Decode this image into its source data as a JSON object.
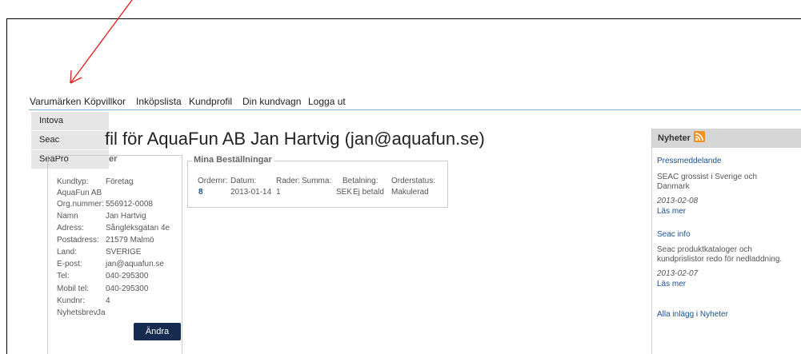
{
  "nav": {
    "items": [
      "Varumärken",
      "Köpvillkor",
      "Inköpslista",
      "Kundprofil",
      "Din kundvagn",
      "Logga ut"
    ]
  },
  "dropdown": {
    "items": [
      "Intova",
      "Seac",
      "SeaPro"
    ]
  },
  "profile": {
    "title": "fil för AquaFun AB Jan Hartvig (jan@aquafun.se)",
    "legend_fragment": "er",
    "fields": [
      {
        "label": "Kundtyp:",
        "value": "Företag"
      },
      {
        "label": "AquaFun AB",
        "value": ""
      },
      {
        "label": "Org.nummer:",
        "value": "556912-0008"
      },
      {
        "label": "Namn",
        "value": "Jan Hartvig"
      },
      {
        "label": "Adress:",
        "value": "Sångleksgatan 4e"
      },
      {
        "label": "Postadress:",
        "value": "21579 Malmö"
      },
      {
        "label": "Land:",
        "value": "SVERIGE"
      },
      {
        "label": "E-post:",
        "value": "jan@aquafun.se"
      },
      {
        "label": "Tel:",
        "value": "040-295300"
      },
      {
        "label": "Mobil tel:",
        "value": "040-295300"
      },
      {
        "label": "Kundnr:",
        "value": "4"
      },
      {
        "label": "Nyhetsbrev:",
        "value": "Ja"
      }
    ],
    "edit_button": "Ändra"
  },
  "orders": {
    "legend": "Mina Beställningar",
    "headers": [
      "Ordernr:",
      "Datum:",
      "Rader:",
      "Summa:",
      "Betalning:",
      "Orderstatus:"
    ],
    "rows": [
      {
        "ordernr": "8",
        "datum": "2013-01-14",
        "rader": "1",
        "summa": "SEK",
        "betalning": "Ej betald",
        "status": "Makulerad"
      }
    ]
  },
  "news": {
    "title": "Nyheter",
    "items": [
      {
        "heading": "Pressmeddelande",
        "text1": "SEAC grossist i Sverige och",
        "text2": "Danmark",
        "date": "2013-02-08",
        "more": "Läs mer"
      },
      {
        "heading": "Seac info",
        "text1": "Seac produktkataloger och",
        "text2": "kundprislistor redo för nedladdning.",
        "date": "2013-02-07",
        "more": "Läs mer"
      }
    ],
    "all_link": "Alla inlägg i Nyheter"
  },
  "colors": {
    "arrow": "#e81818",
    "button_bg": "#152b50",
    "link": "#1a4f90",
    "rss": "#f29020"
  }
}
